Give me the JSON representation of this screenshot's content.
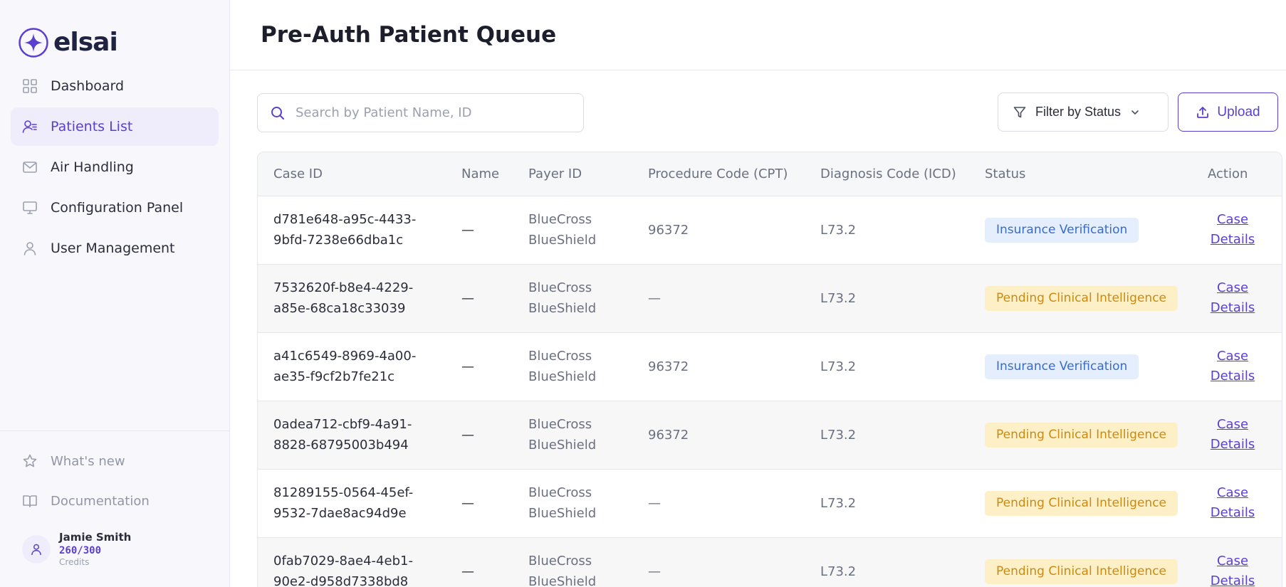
{
  "brand": {
    "name": "elsai",
    "accent": "#5b3fd1"
  },
  "nav": {
    "items": [
      {
        "label": "Dashboard",
        "icon": "grid-icon",
        "active": false
      },
      {
        "label": "Patients List",
        "icon": "user-list-icon",
        "active": true
      },
      {
        "label": "Air Handling",
        "icon": "mail-icon",
        "active": false
      },
      {
        "label": "Configuration Panel",
        "icon": "monitor-icon",
        "active": false
      },
      {
        "label": "User Management",
        "icon": "user-icon",
        "active": false
      }
    ]
  },
  "sidebar_bottom": {
    "whats_new": "What's new",
    "documentation": "Documentation"
  },
  "user": {
    "name": "Jamie Smith",
    "credits": "260/300",
    "credits_label": "Credits"
  },
  "header": {
    "title": "Pre-Auth Patient Queue"
  },
  "toolbar": {
    "search_placeholder": "Search by Patient Name, ID",
    "filter_label": "Filter by Status",
    "upload_label": "Upload"
  },
  "table": {
    "columns": [
      "Case ID",
      "Name",
      "Payer ID",
      "Procedure Code (CPT)",
      "Diagnosis Code (ICD)",
      "Status",
      "Action"
    ],
    "rows": [
      {
        "case_id_1": "d781e648-a95c-4433-",
        "case_id_2": "9bfd-7238e66dba1c",
        "name": "—",
        "payer_1": "BlueCross",
        "payer_2": "BlueShield",
        "cpt": "96372",
        "icd": "L73.2",
        "status": "Insurance Verification",
        "status_color": "blue",
        "action_1": "Case",
        "action_2": "Details"
      },
      {
        "case_id_1": "7532620f-b8e4-4229-",
        "case_id_2": "a85e-68ca18c33039",
        "name": "—",
        "payer_1": "BlueCross",
        "payer_2": "BlueShield",
        "cpt": "—",
        "icd": "L73.2",
        "status": "Pending Clinical Intelligence",
        "status_color": "amber",
        "action_1": "Case",
        "action_2": "Details"
      },
      {
        "case_id_1": "a41c6549-8969-4a00-",
        "case_id_2": "ae35-f9cf2b7fe21c",
        "name": "—",
        "payer_1": "BlueCross",
        "payer_2": "BlueShield",
        "cpt": "96372",
        "icd": "L73.2",
        "status": "Insurance Verification",
        "status_color": "blue",
        "action_1": "Case",
        "action_2": "Details"
      },
      {
        "case_id_1": "0adea712-cbf9-4a91-",
        "case_id_2": "8828-68795003b494",
        "name": "—",
        "payer_1": "BlueCross",
        "payer_2": "BlueShield",
        "cpt": "96372",
        "icd": "L73.2",
        "status": "Pending Clinical Intelligence",
        "status_color": "amber",
        "action_1": "Case",
        "action_2": "Details"
      },
      {
        "case_id_1": "81289155-0564-45ef-",
        "case_id_2": "9532-7dae8ac94d9e",
        "name": "—",
        "payer_1": "BlueCross",
        "payer_2": "BlueShield",
        "cpt": "—",
        "icd": "L73.2",
        "status": "Pending Clinical Intelligence",
        "status_color": "amber",
        "action_1": "Case",
        "action_2": "Details"
      },
      {
        "case_id_1": "0fab7029-8ae4-4eb1-",
        "case_id_2": "90e2-d958d7338bd8",
        "name": "—",
        "payer_1": "BlueCross",
        "payer_2": "BlueShield",
        "cpt": "—",
        "icd": "L73.2",
        "status": "Pending Clinical Intelligence",
        "status_color": "amber",
        "action_1": "Case",
        "action_2": "Details"
      }
    ]
  }
}
